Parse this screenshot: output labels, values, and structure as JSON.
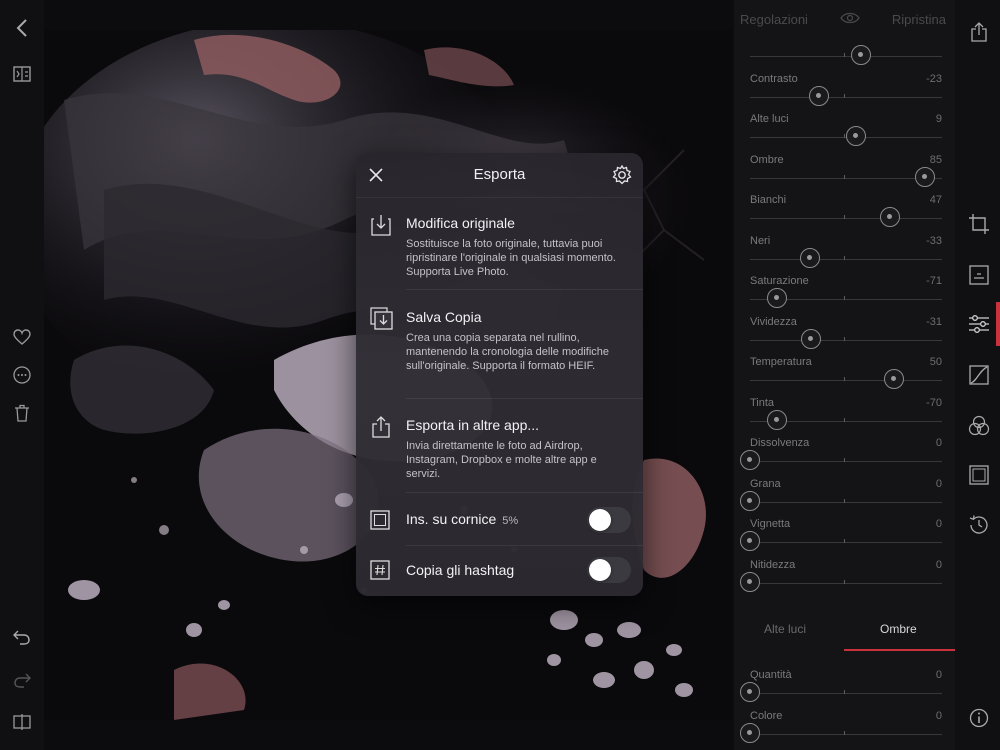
{
  "panel": {
    "header_left": "Regolazioni",
    "header_right": "Ripristina",
    "sliders": [
      {
        "label": "",
        "value": "",
        "pos": 0.58
      },
      {
        "label": "Contrasto",
        "value": "-23",
        "pos": 0.36
      },
      {
        "label": "Alte luci",
        "value": "9",
        "pos": 0.55
      },
      {
        "label": "Ombre",
        "value": "85",
        "pos": 0.91
      },
      {
        "label": "Bianchi",
        "value": "47",
        "pos": 0.73
      },
      {
        "label": "Neri",
        "value": "-33",
        "pos": 0.31
      },
      {
        "label": "Saturazione",
        "value": "-71",
        "pos": 0.14
      },
      {
        "label": "Vividezza",
        "value": "-31",
        "pos": 0.32
      },
      {
        "label": "Temperatura",
        "value": "50",
        "pos": 0.75
      },
      {
        "label": "Tinta",
        "value": "-70",
        "pos": 0.14
      },
      {
        "label": "Dissolvenza",
        "value": "0",
        "pos": 0.0
      },
      {
        "label": "Grana",
        "value": "0",
        "pos": 0.0
      },
      {
        "label": "Vignetta",
        "value": "0",
        "pos": 0.0
      },
      {
        "label": "Nitidezza",
        "value": "0",
        "pos": 0.0
      }
    ],
    "split_tabs": [
      "Alte luci",
      "Ombre"
    ],
    "split_sliders": [
      {
        "label": "Quantità",
        "value": "0",
        "pos": 0.0
      },
      {
        "label": "Colore",
        "value": "0",
        "pos": 0.0
      }
    ]
  },
  "dialog": {
    "title": "Esporta",
    "options": [
      {
        "title": "Modifica originale",
        "desc": "Sostituisce la foto originale, tuttavia puoi ripristinare l'originale in qualsiasi momento. Supporta Live Photo."
      },
      {
        "title": "Salva Copia",
        "desc": "Crea una copia separata nel rullino, mantenendo la cronologia delle modifiche sull'originale. Supporta il formato HEIF."
      },
      {
        "title": "Esporta in altre app...",
        "desc": "Invia direttamente le foto ad Airdrop, Instagram, Dropbox e molte altre app e servizi."
      }
    ],
    "toggles": [
      {
        "title": "Ins. su cornice",
        "extra": "5%",
        "on": false
      },
      {
        "title": "Copia gli hashtag",
        "extra": "",
        "on": false
      }
    ]
  },
  "colors": {
    "accent": "#c8323a",
    "background": "#0c0c0e"
  },
  "icons": {
    "left": [
      "back-icon",
      "compare-icon",
      "heart-icon",
      "more-icon",
      "trash-icon",
      "undo-icon",
      "redo-icon",
      "split-view-icon"
    ],
    "right": [
      "share-icon",
      "crop-icon",
      "text-icon",
      "adjust-icon",
      "curves-icon",
      "color-mix-icon",
      "frame-icon",
      "history-icon",
      "info-icon"
    ]
  }
}
